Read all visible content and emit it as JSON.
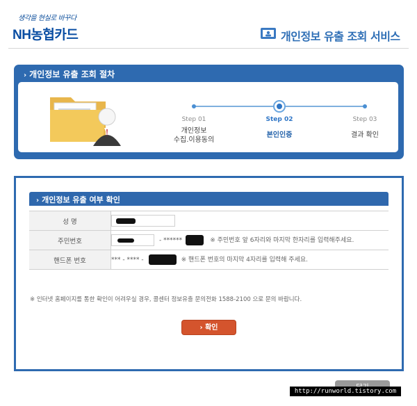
{
  "header": {
    "slogan": "생각을 현실로 바꾸다",
    "brand": "NH농협카드",
    "service_title": "개인정보 유출 조회 서비스"
  },
  "process": {
    "title": "개인정보 유출 조회 절차",
    "steps": [
      {
        "label": "Step 01",
        "name_line1": "개인정보",
        "name_line2": "수집.이용동의",
        "active": false
      },
      {
        "label": "Step 02",
        "name_line1": "본인인증",
        "name_line2": "",
        "active": true
      },
      {
        "label": "Step 03",
        "name_line1": "결과 확인",
        "name_line2": "",
        "active": false
      }
    ]
  },
  "form": {
    "title": "개인정보 유출 여부 확인",
    "rows": [
      {
        "label": "성 명"
      },
      {
        "label": "주민번호",
        "mask": "- ******",
        "note": "※ 주민번호 앞 6자리와 마지막 한자리를 입력해주세요."
      },
      {
        "label": "핸드폰 번호",
        "mask": "*** - **** -",
        "note": "※ 핸드폰 번호의 마지막 4자리를 입력해 주세요."
      }
    ],
    "info": "※ 인터넷 홈페이지를 통한 확인이 어려우실 경우, 콜센터 정보유출 문의전화 1588-2100 으로 문의 바랍니다.",
    "confirm_label": "확인"
  },
  "footer": {
    "close_label": "닫기",
    "url": "http://runworld.tistory.com"
  },
  "colors": {
    "accent_blue": "#2e6ab0",
    "button_orange": "#d4542d"
  }
}
